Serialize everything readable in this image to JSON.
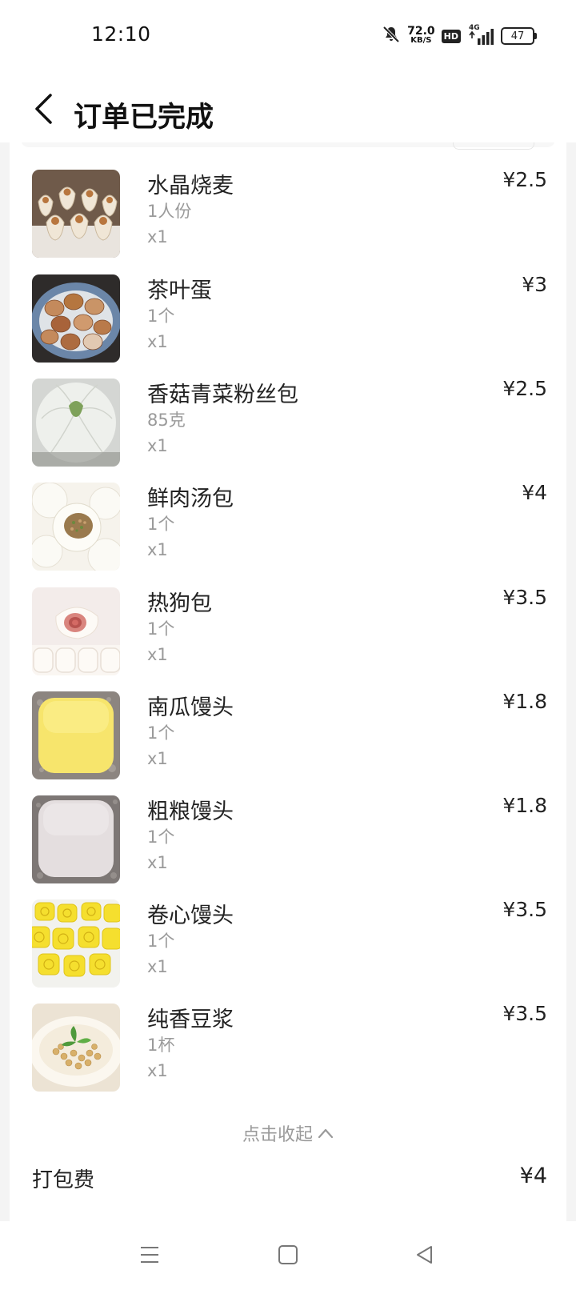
{
  "status_bar": {
    "time": "12:10",
    "net_speed_value": "72.0",
    "net_speed_unit": "KB/S",
    "hd_label": "HD",
    "network_label": "4G",
    "battery": "47",
    "icons": [
      "bell-mute-icon",
      "signal-icon",
      "battery-icon"
    ]
  },
  "header": {
    "title": "订单已完成",
    "back_icon": "chevron-left-icon"
  },
  "items": [
    {
      "name": "水晶烧麦",
      "spec": "1人份",
      "qty": "x1",
      "price": "¥2.5",
      "image": "shaomai"
    },
    {
      "name": "茶叶蛋",
      "spec": "1个",
      "qty": "x1",
      "price": "¥3",
      "image": "tea-egg"
    },
    {
      "name": "香菇青菜粉丝包",
      "spec": "85克",
      "qty": "x1",
      "price": "¥2.5",
      "image": "veg-bun"
    },
    {
      "name": "鲜肉汤包",
      "spec": "1个",
      "qty": "x1",
      "price": "¥4",
      "image": "soup-bun"
    },
    {
      "name": "热狗包",
      "spec": "1个",
      "qty": "x1",
      "price": "¥3.5",
      "image": "hotdog-bun"
    },
    {
      "name": "南瓜馒头",
      "spec": "1个",
      "qty": "x1",
      "price": "¥1.8",
      "image": "pumpkin-mantou"
    },
    {
      "name": "粗粮馒头",
      "spec": "1个",
      "qty": "x1",
      "price": "¥1.8",
      "image": "grain-mantou"
    },
    {
      "name": "卷心馒头",
      "spec": "1个",
      "qty": "x1",
      "price": "¥3.5",
      "image": "roll-mantou"
    },
    {
      "name": "纯香豆浆",
      "spec": "1杯",
      "qty": "x1",
      "price": "¥3.5",
      "image": "soymilk"
    }
  ],
  "collapse": {
    "label": "点击收起",
    "icon": "chevron-up-icon"
  },
  "packing_fee": {
    "label": "打包费",
    "value": "¥4"
  },
  "nav": {
    "icons": [
      "menu-icon",
      "home-icon",
      "back-triangle-icon"
    ]
  }
}
